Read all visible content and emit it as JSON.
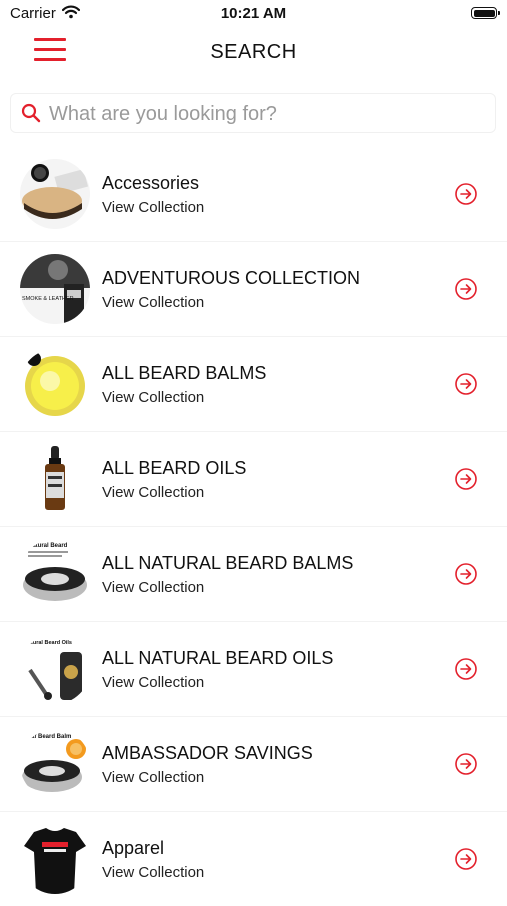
{
  "status_bar": {
    "carrier": "Carrier",
    "time": "10:21 AM"
  },
  "nav": {
    "title": "SEARCH"
  },
  "search": {
    "placeholder": "What are you looking for?"
  },
  "accent_color": "#e3202c",
  "collections": [
    {
      "title": "Accessories",
      "subtitle": "View Collection",
      "thumb": "brush"
    },
    {
      "title": "ADVENTUROUS COLLECTION",
      "subtitle": "View Collection",
      "thumb": "adventurous",
      "thumb_text": "SMOKE & LEATHER"
    },
    {
      "title": "ALL BEARD BALMS",
      "subtitle": "View Collection",
      "thumb": "balm-yellow"
    },
    {
      "title": "ALL BEARD OILS",
      "subtitle": "View Collection",
      "thumb": "oil-bottle"
    },
    {
      "title": "ALL NATURAL BEARD BALMS",
      "subtitle": "View Collection",
      "thumb": "tin",
      "thumb_text": "Natural Beard"
    },
    {
      "title": "ALL NATURAL BEARD OILS",
      "subtitle": "View Collection",
      "thumb": "natural-oil",
      "thumb_text": "Natural Beard Oils"
    },
    {
      "title": "AMBASSADOR SAVINGS",
      "subtitle": "View Collection",
      "thumb": "tin-orange",
      "thumb_text": "Leaf Beard Balm"
    },
    {
      "title": "Apparel",
      "subtitle": "View Collection",
      "thumb": "tshirt"
    }
  ]
}
